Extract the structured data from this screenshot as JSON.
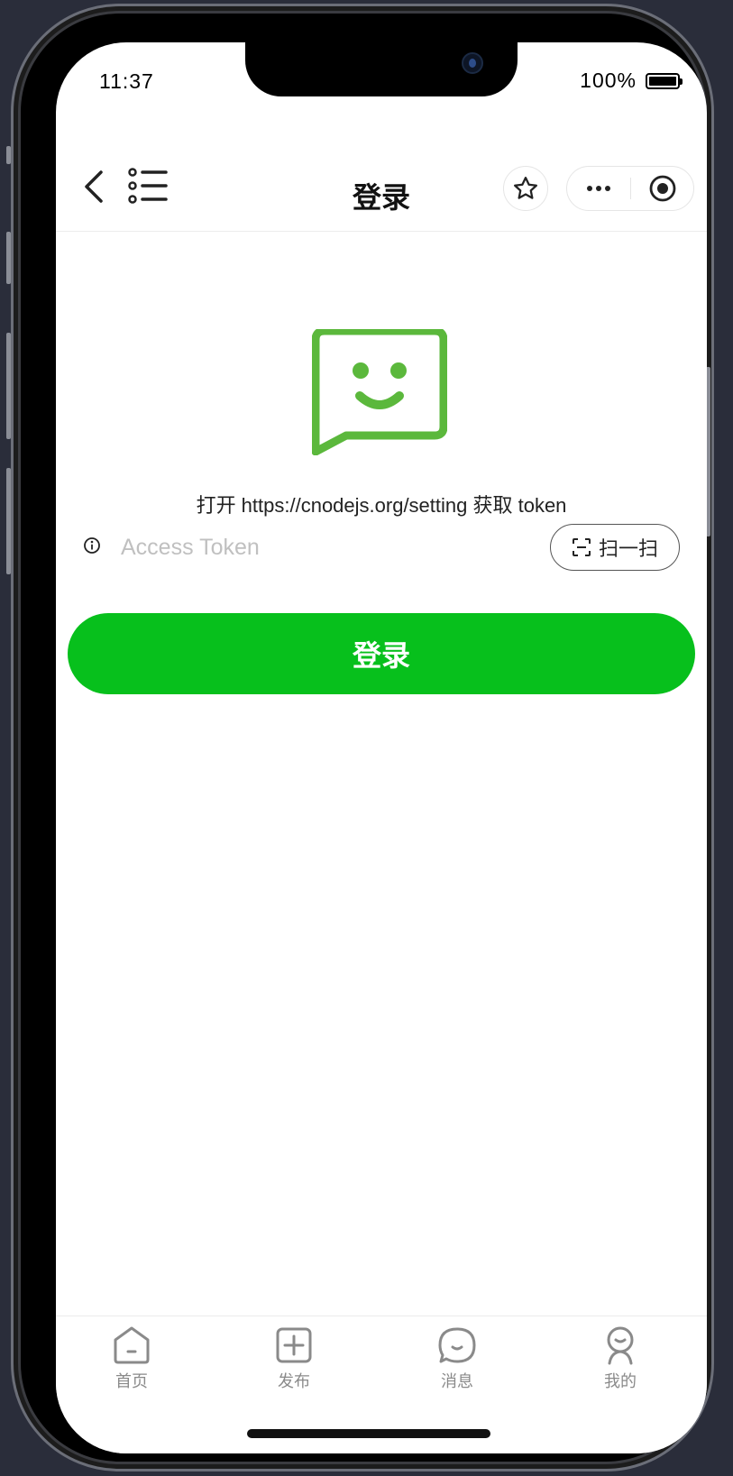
{
  "status_bar": {
    "time": "11:37",
    "battery": "100%"
  },
  "nav": {
    "title": "登录",
    "icons": [
      "back-icon",
      "list-icon",
      "star-icon",
      "more-icon",
      "close-icon"
    ]
  },
  "login": {
    "hint": "打开 https://cnodejs.org/setting 获取 token",
    "token_placeholder": "Access Token",
    "token_value": "",
    "scan_label": "扫一扫",
    "submit_label": "登录",
    "accent_color": "#07c01c",
    "logo_color": "#5bb83c"
  },
  "tabbar": {
    "items": [
      {
        "label": "首页",
        "icon": "home-icon"
      },
      {
        "label": "发布",
        "icon": "add-icon"
      },
      {
        "label": "消息",
        "icon": "message-icon"
      },
      {
        "label": "我的",
        "icon": "profile-icon"
      }
    ]
  }
}
